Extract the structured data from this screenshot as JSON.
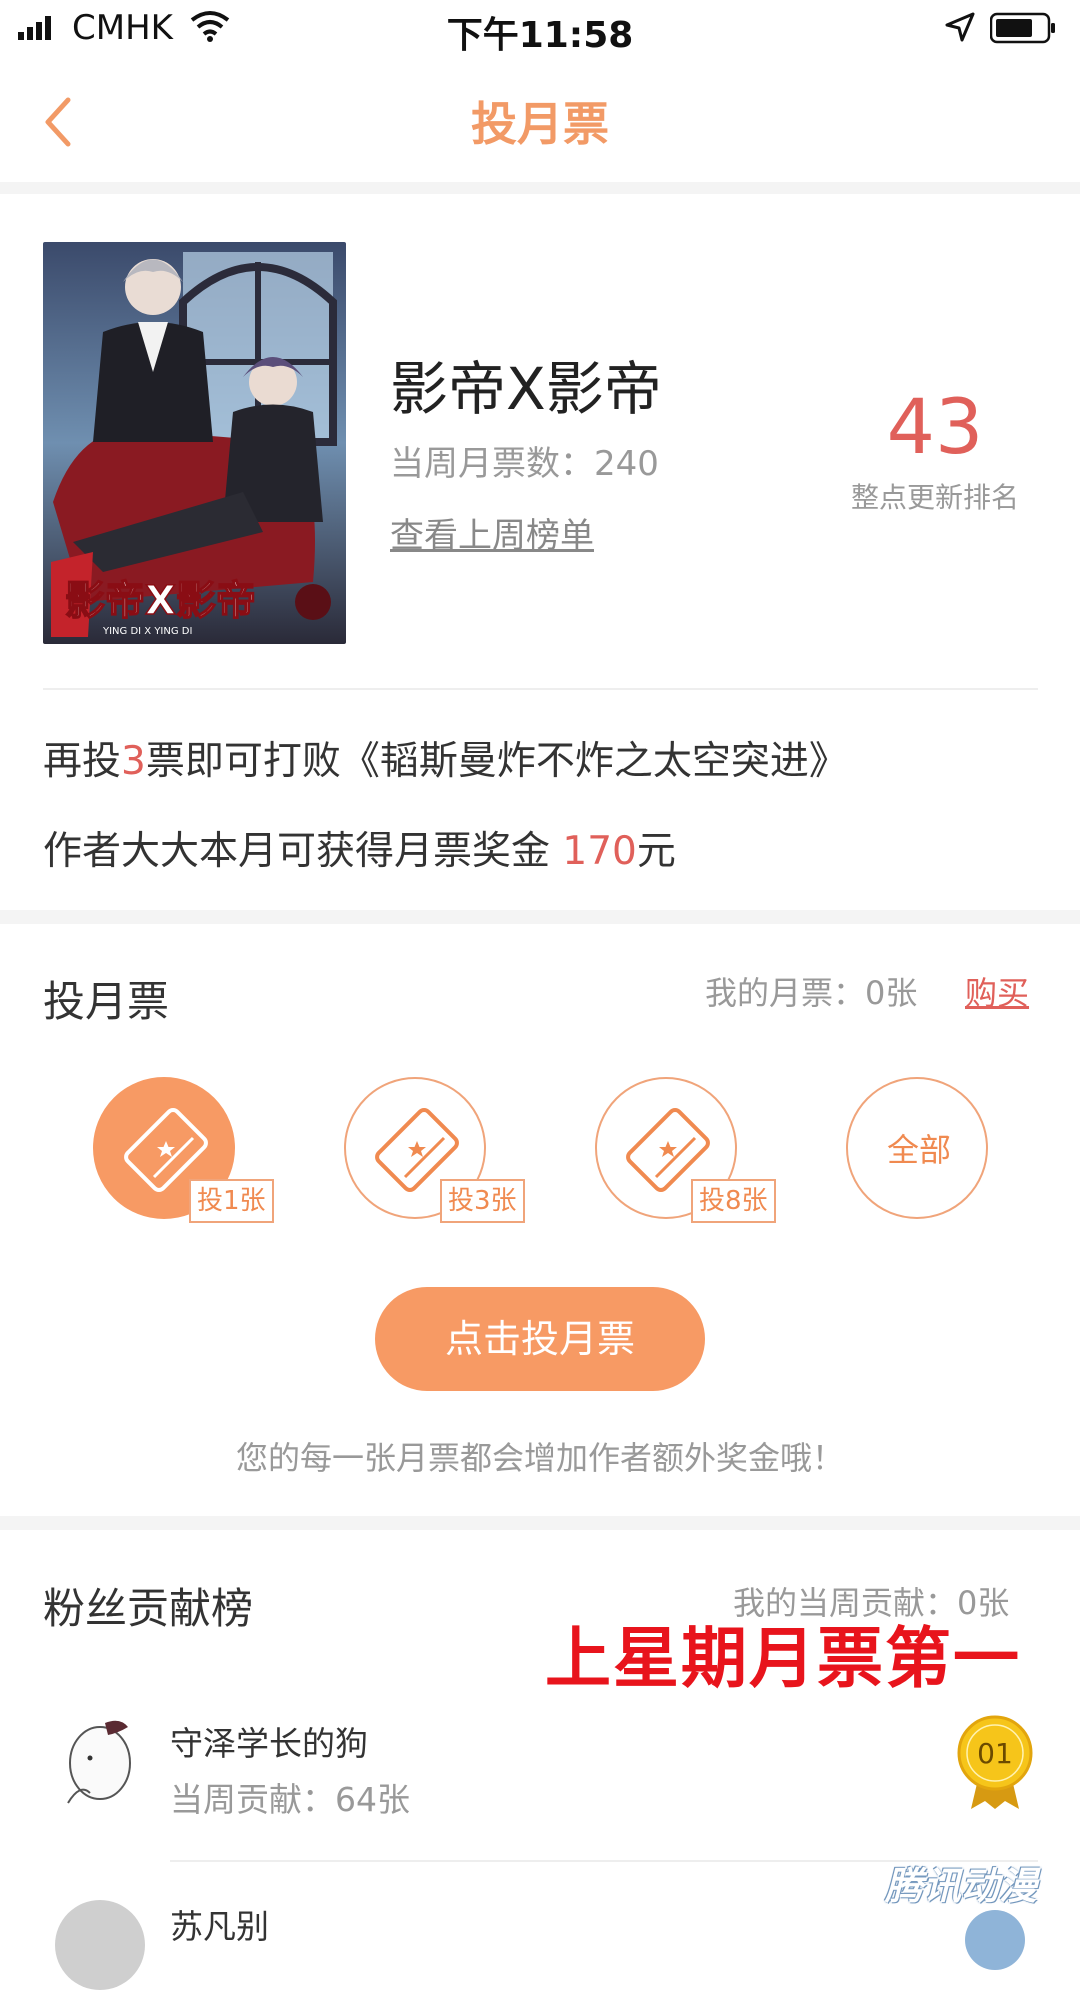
{
  "status_bar": {
    "carrier": "CMHK",
    "time": "下午11:58"
  },
  "nav": {
    "title": "投月票"
  },
  "book": {
    "title": "影帝X影帝",
    "weekly_votes": "当周月票数：240",
    "last_week_link": "查看上周榜单",
    "rank": "43",
    "rank_caption": "整点更新排名",
    "cover_text": "影帝X影帝",
    "cover_subtext": "YING DI X YING DI"
  },
  "beat": {
    "prefix": "再投",
    "count": "3",
    "suffix": "票即可打败《韬斯曼炸不炸之太空突进》"
  },
  "bonus": {
    "prefix": "作者大大本月可获得月票奖金 ",
    "amount": "170",
    "suffix": "元"
  },
  "vote": {
    "title": "投月票",
    "my_tickets": "我的月票：0张",
    "buy": "购买",
    "options": [
      {
        "label": "投1张",
        "selected": true
      },
      {
        "label": "投3张",
        "selected": false
      },
      {
        "label": "投8张",
        "selected": false
      },
      {
        "label": "全部",
        "selected": false
      }
    ],
    "button": "点击投月票",
    "tip": "您的每一张月票都会增加作者额外奖金哦！"
  },
  "fans": {
    "title": "粉丝贡献榜",
    "my_contribution": "我的当周贡献：0张",
    "annotation": "上星期月票第一",
    "items": [
      {
        "name": "守泽学长的狗",
        "contribution": "当周贡献：64张",
        "rank": "01"
      },
      {
        "name": "苏凡别"
      }
    ]
  },
  "watermark": "腾讯动漫",
  "colors": {
    "accent": "#f79a64",
    "highlight": "#e0605a",
    "annotation": "#e8141c"
  }
}
